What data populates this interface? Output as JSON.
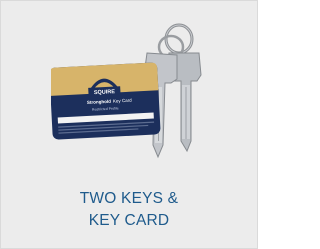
{
  "product_tile": {
    "caption_line1": "TWO KEYS &",
    "caption_line2": "KEY CARD",
    "image_name": "keys-and-key-card-image",
    "card": {
      "brand": "SQUIRE",
      "product_line": "Stronghold",
      "card_title": "Key Card",
      "card_subtitle": "Restricted Profile"
    },
    "colors": {
      "caption": "#1f5b8c",
      "tile_background": "#ececec",
      "card_gold": "#d7b46a",
      "card_navy": "#1c2f5c"
    }
  }
}
